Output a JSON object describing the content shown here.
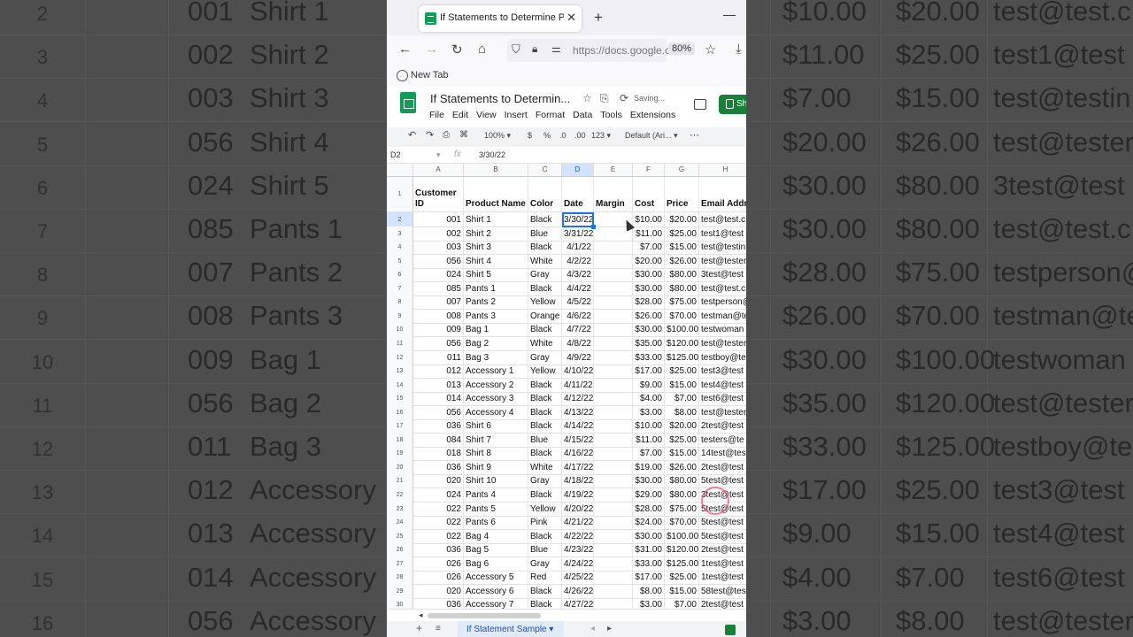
{
  "browser": {
    "tab_title": "If Statements to Determine Profit",
    "new_tab_symbol": "+",
    "url": "https://docs.google.com",
    "zoom": "80%",
    "bookmark": "New Tab"
  },
  "doc": {
    "title": "If Statements to Determin...",
    "status": "Saving...",
    "share_label": "Sh",
    "menu": [
      "File",
      "Edit",
      "View",
      "Insert",
      "Format",
      "Data",
      "Tools",
      "Extensions"
    ]
  },
  "toolbar": {
    "zoom": "100%",
    "currency": "$",
    "percent": "%",
    "dec_less": ".0",
    "dec_more": ".00",
    "format": "123",
    "font": "Default (Ari...",
    "more": "⋯"
  },
  "formula_bar": {
    "name_box": "D2",
    "fx": "fx",
    "value": "3/30/22"
  },
  "columns": [
    "A",
    "B",
    "C",
    "D",
    "E",
    "F",
    "G",
    "H"
  ],
  "header_row": {
    "row": "1",
    "cells": [
      "Customer ID",
      "Product Name",
      "Color",
      "Date",
      "Margin",
      "Cost",
      "Price",
      "Email Addr"
    ]
  },
  "rows": [
    {
      "n": "2",
      "id": "001",
      "product": "Shirt 1",
      "color": "Black",
      "date": "3/30/22",
      "cost": "$10.00",
      "price": "$20.00",
      "email": "test@test.c"
    },
    {
      "n": "3",
      "id": "002",
      "product": "Shirt 2",
      "color": "Blue",
      "date": "3/31/22",
      "cost": "$11.00",
      "price": "$25.00",
      "email": "test1@test"
    },
    {
      "n": "4",
      "id": "003",
      "product": "Shirt 3",
      "color": "Black",
      "date": "4/1/22",
      "cost": "$7.00",
      "price": "$15.00",
      "email": "test@testin"
    },
    {
      "n": "5",
      "id": "056",
      "product": "Shirt 4",
      "color": "White",
      "date": "4/2/22",
      "cost": "$20.00",
      "price": "$26.00",
      "email": "test@tester"
    },
    {
      "n": "6",
      "id": "024",
      "product": "Shirt 5",
      "color": "Gray",
      "date": "4/3/22",
      "cost": "$30.00",
      "price": "$80.00",
      "email": "3test@test"
    },
    {
      "n": "7",
      "id": "085",
      "product": "Pants 1",
      "color": "Black",
      "date": "4/4/22",
      "cost": "$30.00",
      "price": "$80.00",
      "email": "test@test.c"
    },
    {
      "n": "8",
      "id": "007",
      "product": "Pants 2",
      "color": "Yellow",
      "date": "4/5/22",
      "cost": "$28.00",
      "price": "$75.00",
      "email": "testperson@"
    },
    {
      "n": "9",
      "id": "008",
      "product": "Pants 3",
      "color": "Orange",
      "date": "4/6/22",
      "cost": "$26.00",
      "price": "$70.00",
      "email": "testman@te"
    },
    {
      "n": "10",
      "id": "009",
      "product": "Bag 1",
      "color": "Black",
      "date": "4/7/22",
      "cost": "$30.00",
      "price": "$100.00",
      "email": "testwoman"
    },
    {
      "n": "11",
      "id": "056",
      "product": "Bag 2",
      "color": "White",
      "date": "4/8/22",
      "cost": "$35.00",
      "price": "$120.00",
      "email": "test@tester"
    },
    {
      "n": "12",
      "id": "011",
      "product": "Bag 3",
      "color": "Gray",
      "date": "4/9/22",
      "cost": "$33.00",
      "price": "$125.00",
      "email": "testboy@te"
    },
    {
      "n": "13",
      "id": "012",
      "product": "Accessory 1",
      "color": "Yellow",
      "date": "4/10/22",
      "cost": "$17.00",
      "price": "$25.00",
      "email": "test3@test"
    },
    {
      "n": "14",
      "id": "013",
      "product": "Accessory 2",
      "color": "Black",
      "date": "4/11/22",
      "cost": "$9.00",
      "price": "$15.00",
      "email": "test4@test"
    },
    {
      "n": "15",
      "id": "014",
      "product": "Accessory 3",
      "color": "Black",
      "date": "4/12/22",
      "cost": "$4.00",
      "price": "$7.00",
      "email": "test6@test"
    },
    {
      "n": "16",
      "id": "056",
      "product": "Accessory 4",
      "color": "Black",
      "date": "4/13/22",
      "cost": "$3.00",
      "price": "$8.00",
      "email": "test@tester"
    },
    {
      "n": "17",
      "id": "036",
      "product": "Shirt 6",
      "color": "Black",
      "date": "4/14/22",
      "cost": "$10.00",
      "price": "$20.00",
      "email": "2test@test"
    },
    {
      "n": "18",
      "id": "084",
      "product": "Shirt 7",
      "color": "Blue",
      "date": "4/15/22",
      "cost": "$11.00",
      "price": "$25.00",
      "email": "testers@te"
    },
    {
      "n": "19",
      "id": "018",
      "product": "Shirt 8",
      "color": "Black",
      "date": "4/16/22",
      "cost": "$7.00",
      "price": "$15.00",
      "email": "14test@test"
    },
    {
      "n": "20",
      "id": "036",
      "product": "Shirt 9",
      "color": "White",
      "date": "4/17/22",
      "cost": "$19.00",
      "price": "$26.00",
      "email": "2test@test"
    },
    {
      "n": "21",
      "id": "020",
      "product": "Shirt 10",
      "color": "Gray",
      "date": "4/18/22",
      "cost": "$30.00",
      "price": "$80.00",
      "email": "5test@test"
    },
    {
      "n": "22",
      "id": "024",
      "product": "Pants 4",
      "color": "Black",
      "date": "4/19/22",
      "cost": "$29.00",
      "price": "$80.00",
      "email": "3test@test"
    },
    {
      "n": "23",
      "id": "022",
      "product": "Pants 5",
      "color": "Yellow",
      "date": "4/20/22",
      "cost": "$28.00",
      "price": "$75.00",
      "email": "5test@test"
    },
    {
      "n": "24",
      "id": "022",
      "product": "Pants 6",
      "color": "Pink",
      "date": "4/21/22",
      "cost": "$24.00",
      "price": "$70.00",
      "email": "5test@test"
    },
    {
      "n": "25",
      "id": "022",
      "product": "Bag 4",
      "color": "Black",
      "date": "4/22/22",
      "cost": "$30.00",
      "price": "$100.00",
      "email": "5test@test"
    },
    {
      "n": "26",
      "id": "036",
      "product": "Bag 5",
      "color": "Blue",
      "date": "4/23/22",
      "cost": "$31.00",
      "price": "$120.00",
      "email": "2test@test"
    },
    {
      "n": "27",
      "id": "026",
      "product": "Bag 6",
      "color": "Gray",
      "date": "4/24/22",
      "cost": "$33.00",
      "price": "$125.00",
      "email": "1test@test"
    },
    {
      "n": "28",
      "id": "026",
      "product": "Accessory 5",
      "color": "Red",
      "date": "4/25/22",
      "cost": "$17.00",
      "price": "$25.00",
      "email": "1test@test"
    },
    {
      "n": "29",
      "id": "020",
      "product": "Accessory 6",
      "color": "Black",
      "date": "4/26/22",
      "cost": "$8.00",
      "price": "$15.00",
      "email": "58test@tes"
    },
    {
      "n": "30",
      "id": "036",
      "product": "Accessory 7",
      "color": "Black",
      "date": "4/27/22",
      "cost": "$3.00",
      "price": "$7.00",
      "email": "2test@test"
    }
  ],
  "sheet_tab": "If Statement Sample",
  "background_zoom": {
    "rows": [
      {
        "n": "2",
        "id": "001",
        "product": "Shirt 1",
        "cost": "$10.00",
        "price": "$20.00",
        "email": "test@test.c"
      },
      {
        "n": "3",
        "id": "002",
        "product": "Shirt 2",
        "cost": "$11.00",
        "price": "$25.00",
        "email": "test1@test"
      },
      {
        "n": "4",
        "id": "003",
        "product": "Shirt 3",
        "cost": "$7.00",
        "price": "$15.00",
        "email": "test@testin"
      },
      {
        "n": "5",
        "id": "056",
        "product": "Shirt 4",
        "cost": "$20.00",
        "price": "$26.00",
        "email": "test@tester"
      },
      {
        "n": "6",
        "id": "024",
        "product": "Shirt 5",
        "cost": "$30.00",
        "price": "$80.00",
        "email": "3test@test"
      },
      {
        "n": "7",
        "id": "085",
        "product": "Pants 1",
        "cost": "$30.00",
        "price": "$80.00",
        "email": "test@test.c"
      },
      {
        "n": "8",
        "id": "007",
        "product": "Pants 2",
        "cost": "$28.00",
        "price": "$75.00",
        "email": "testperson@"
      },
      {
        "n": "9",
        "id": "008",
        "product": "Pants 3",
        "cost": "$26.00",
        "price": "$70.00",
        "email": "testman@te"
      },
      {
        "n": "10",
        "id": "009",
        "product": "Bag 1",
        "cost": "$30.00",
        "price": "$100.00",
        "email": "testwoman"
      },
      {
        "n": "11",
        "id": "056",
        "product": "Bag 2",
        "cost": "$35.00",
        "price": "$120.00",
        "email": "test@tester"
      },
      {
        "n": "12",
        "id": "011",
        "product": "Bag 3",
        "cost": "$33.00",
        "price": "$125.00",
        "email": "testboy@te"
      },
      {
        "n": "13",
        "id": "012",
        "product": "Accessory",
        "cost": "$17.00",
        "price": "$25.00",
        "email": "test3@test"
      },
      {
        "n": "14",
        "id": "013",
        "product": "Accessory",
        "cost": "$9.00",
        "price": "$15.00",
        "email": "test4@test"
      },
      {
        "n": "15",
        "id": "014",
        "product": "Accessory",
        "cost": "$4.00",
        "price": "$7.00",
        "email": "test6@test"
      },
      {
        "n": "16",
        "id": "056",
        "product": "Accessory",
        "cost": "$3.00",
        "price": "$8.00",
        "email": "test@tester"
      }
    ]
  },
  "colors": {
    "sheets_green": "#0f9d58",
    "selection_blue": "#1a73e8",
    "share_green": "#188038"
  }
}
